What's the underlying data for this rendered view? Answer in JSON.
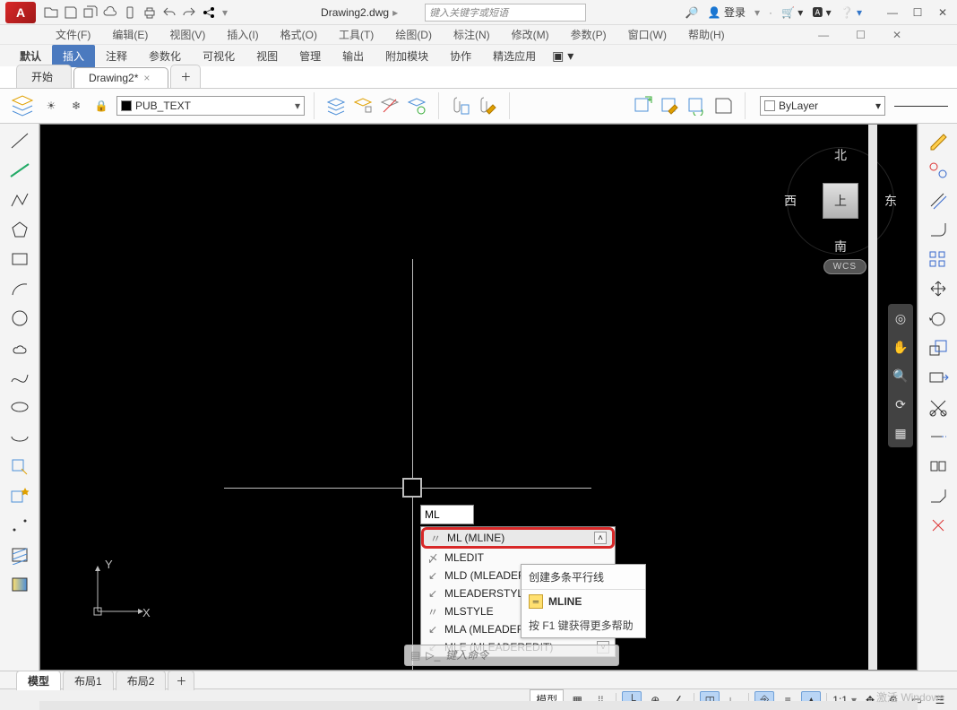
{
  "title": {
    "doc_name": "Drawing2.dwg",
    "search_placeholder": "键入关键字或短语",
    "login": "登录"
  },
  "menu": [
    "文件(F)",
    "编辑(E)",
    "视图(V)",
    "插入(I)",
    "格式(O)",
    "工具(T)",
    "绘图(D)",
    "标注(N)",
    "修改(M)",
    "参数(P)",
    "窗口(W)",
    "帮助(H)"
  ],
  "ribbon_tabs": [
    "默认",
    "插入",
    "注释",
    "参数化",
    "可视化",
    "视图",
    "管理",
    "输出",
    "附加模块",
    "协作",
    "精选应用"
  ],
  "ribbon_active_index": 1,
  "file_tabs": {
    "items": [
      "开始",
      "Drawing2*"
    ],
    "active_index": 1
  },
  "layer": {
    "current": "PUB_TEXT"
  },
  "props": {
    "color_label": "ByLayer"
  },
  "viewcube": {
    "n": "北",
    "s": "南",
    "e": "东",
    "w": "西",
    "face": "上",
    "wcs": "WCS"
  },
  "ucs": {
    "x": "X",
    "y": "Y"
  },
  "cmd": {
    "typed": "ML",
    "placeholder": "键入命令"
  },
  "autocomplete": {
    "items": [
      {
        "label": "ML (MLINE)",
        "sel": true
      },
      {
        "label": "MLEDIT"
      },
      {
        "label": "MLD (MLEADER)"
      },
      {
        "label": "MLEADERSTYLE"
      },
      {
        "label": "MLSTYLE"
      },
      {
        "label": "MLA (MLEADERALIGN)"
      },
      {
        "label": "MLE (MLEADEREDIT)"
      }
    ]
  },
  "tooltip": {
    "desc": "创建多条平行线",
    "cmd": "MLINE",
    "help": "按 F1 键获得更多帮助"
  },
  "bottom_tabs": [
    "模型",
    "布局1",
    "布局2"
  ],
  "status": {
    "space": "模型",
    "scale": "1:1",
    "activate": "激活 Windows"
  }
}
